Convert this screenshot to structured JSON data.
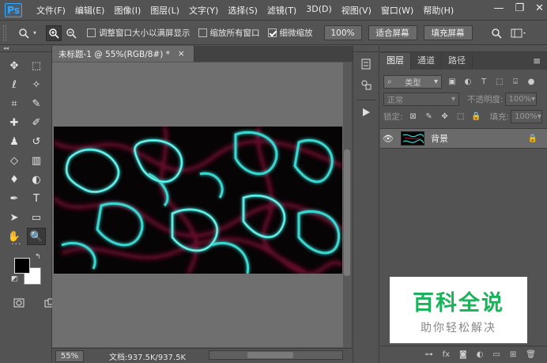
{
  "app": {
    "logo": "Ps"
  },
  "menu": [
    "文件(F)",
    "编辑(E)",
    "图像(I)",
    "图层(L)",
    "文字(Y)",
    "选择(S)",
    "滤镜(T)",
    "3D(D)",
    "视图(V)",
    "窗口(W)",
    "帮助(H)"
  ],
  "window_controls": {
    "minimize": "—",
    "restore": "❐",
    "close": "✕"
  },
  "options": {
    "resize_windows_label": "调整窗口大小以满屏显示",
    "resize_windows_checked": false,
    "zoom_all_label": "缩放所有窗口",
    "zoom_all_checked": false,
    "scrubby_zoom_label": "细微缩放",
    "scrubby_zoom_checked": true,
    "btn_100": "100%",
    "btn_fit_screen": "适合屏幕",
    "btn_fill_screen": "填充屏幕"
  },
  "document": {
    "tab_title": "未标题-1 @ 55%(RGB/8#) *",
    "tab_close": "×",
    "zoom": "55%",
    "doc_info": "文档:937.5K/937.5K",
    "status_arrow": "›"
  },
  "tools": [
    {
      "name": "move-tool",
      "glyph": "✥",
      "active": false
    },
    {
      "name": "marquee-tool",
      "glyph": "⬚",
      "active": false
    },
    {
      "name": "lasso-tool",
      "glyph": "ℓ",
      "active": false
    },
    {
      "name": "magic-wand-tool",
      "glyph": "✧",
      "active": false
    },
    {
      "name": "crop-tool",
      "glyph": "⌗",
      "active": false
    },
    {
      "name": "eyedropper-tool",
      "glyph": "✎",
      "active": false
    },
    {
      "name": "healing-brush-tool",
      "glyph": "✚",
      "active": false
    },
    {
      "name": "brush-tool",
      "glyph": "✐",
      "active": false
    },
    {
      "name": "clone-stamp-tool",
      "glyph": "♟",
      "active": false
    },
    {
      "name": "history-brush-tool",
      "glyph": "↺",
      "active": false
    },
    {
      "name": "eraser-tool",
      "glyph": "◇",
      "active": false
    },
    {
      "name": "gradient-tool",
      "glyph": "▥",
      "active": false
    },
    {
      "name": "blur-tool",
      "glyph": "♦",
      "active": false
    },
    {
      "name": "dodge-tool",
      "glyph": "◐",
      "active": false
    },
    {
      "name": "pen-tool",
      "glyph": "✒",
      "active": false
    },
    {
      "name": "type-tool",
      "glyph": "T",
      "active": false
    },
    {
      "name": "path-selection-tool",
      "glyph": "➤",
      "active": false
    },
    {
      "name": "rectangle-tool",
      "glyph": "▭",
      "active": false
    },
    {
      "name": "hand-tool",
      "glyph": "✋",
      "active": false
    },
    {
      "name": "zoom-tool",
      "glyph": "🔍",
      "active": true
    }
  ],
  "colors": {
    "foreground": "#000000",
    "background": "#ffffff"
  },
  "layers_panel": {
    "tabs": [
      "图层",
      "通道",
      "路径"
    ],
    "active_tab": 0,
    "filter_label": "类型",
    "blend_mode": "正常",
    "opacity_label": "不透明度:",
    "opacity_value": "100%",
    "lock_label": "锁定:",
    "fill_label": "填充:",
    "fill_value": "100%",
    "layers": [
      {
        "name": "背景",
        "visible": true,
        "locked": true
      }
    ]
  },
  "watermark": {
    "main": "百科全说",
    "sub": "助你轻松解决"
  }
}
